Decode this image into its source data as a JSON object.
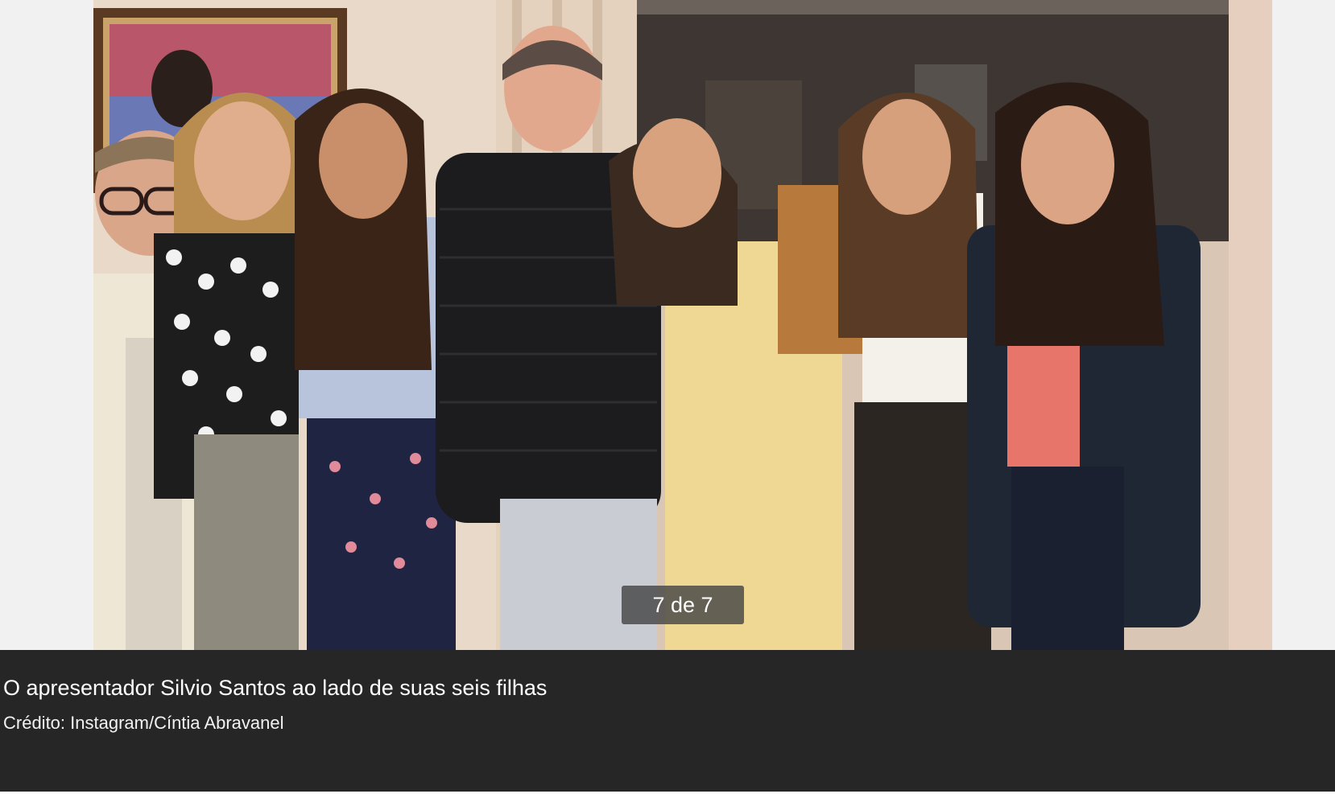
{
  "gallery": {
    "counter": "7 de 7",
    "caption": "O apresentador Silvio Santos ao lado de suas seis filhas",
    "credit": "Crédito: Instagram/Cíntia Abravanel"
  }
}
